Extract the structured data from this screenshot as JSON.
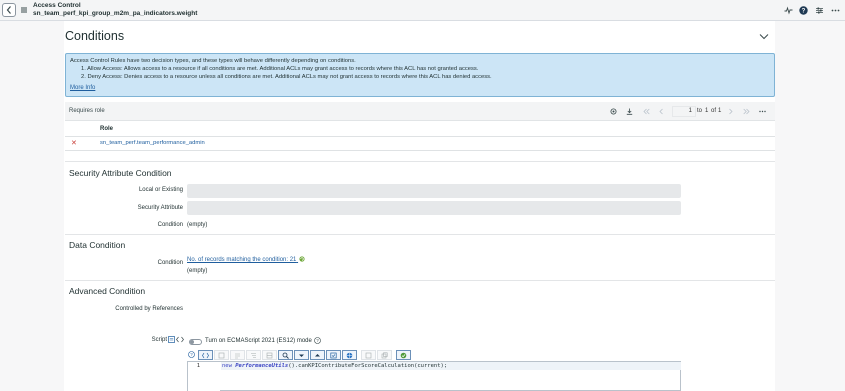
{
  "header": {
    "title": "Access Control",
    "subtitle": "sn_team_perf_kpi_group_m2m_pa_indicators.weight"
  },
  "conditions": {
    "heading": "Conditions",
    "info": {
      "line1": "Access Control Rules have two decision types, and these types will behave differently depending on conditions.",
      "line2": "1. Allow Access: Allows access to a resource if all conditions are met. Additional ACLs may grant access to records where this ACL has not granted access.",
      "line3": "2. Deny Access: Denies access to a resource unless all conditions are met. Additional ACLs may not grant access to records where this ACL has denied access.",
      "more_info": "More Info"
    }
  },
  "requires_role": {
    "label": "Requires role",
    "page_current": "1",
    "page_to": "to",
    "page_end": "1",
    "page_of": "of",
    "page_total": "1",
    "column": "Role",
    "rows": [
      {
        "role": "sn_team_perf.team_performance_admin"
      }
    ]
  },
  "security_attribute": {
    "title": "Security Attribute Condition",
    "local_label": "Local or Existing",
    "attr_label": "Security Attribute",
    "condition_label": "Condition",
    "condition_value": "(empty)"
  },
  "data_condition": {
    "title": "Data Condition",
    "condition_label": "Condition",
    "records_link": "No. of records matching the condition: 21",
    "condition_value": "(empty)"
  },
  "advanced_condition": {
    "title": "Advanced Condition",
    "controlled_label": "Controlled by References",
    "script_label": "Script",
    "es12_label": "Turn on ECMAScript 2021 (ES12) mode",
    "code_line_no": "1",
    "code": {
      "kw": "new",
      "cls": "PerformanceUtils",
      "rest": "().canKPIContributeForScoreCalculation(current);"
    }
  }
}
